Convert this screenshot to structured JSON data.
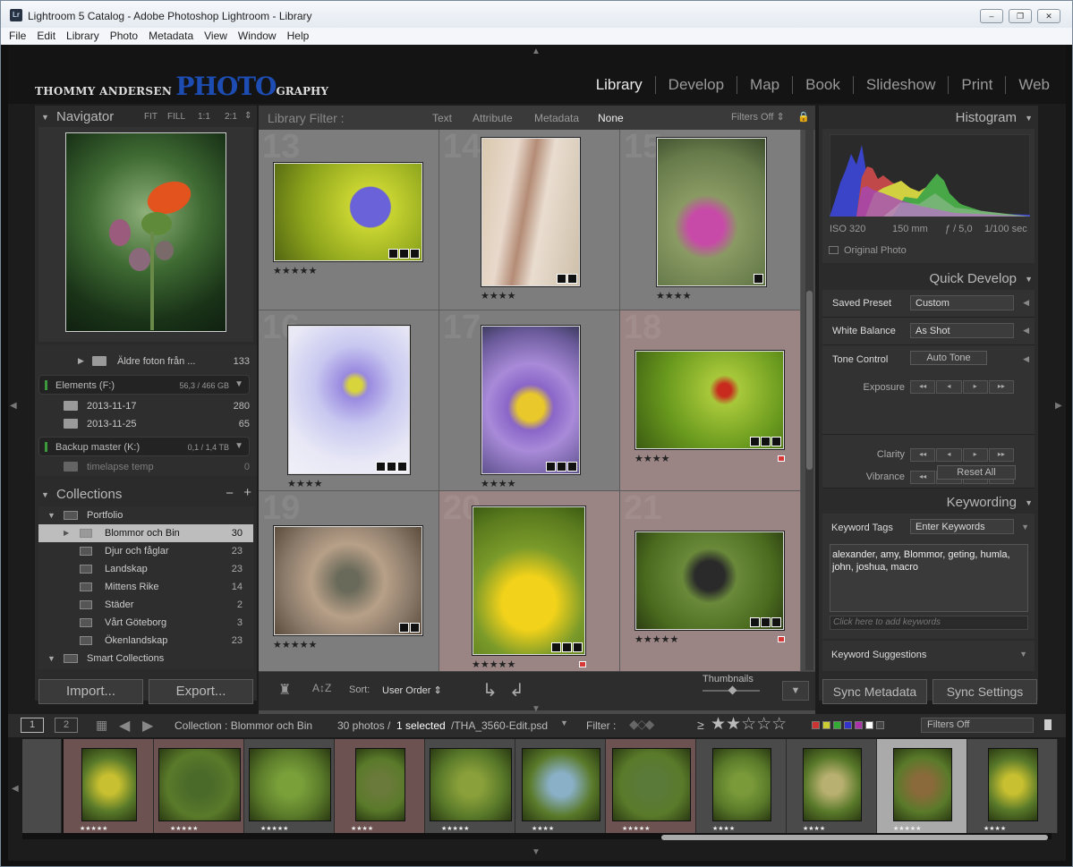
{
  "window": {
    "app_icon": "Lr",
    "title": "Lightroom 5 Catalog - Adobe Photoshop Lightroom - Library",
    "min": "–",
    "max": "❐",
    "close": "✕"
  },
  "menu": [
    "File",
    "Edit",
    "Library",
    "Photo",
    "Metadata",
    "View",
    "Window",
    "Help"
  ],
  "identity": {
    "part1": "THOMMY ANDERSEN",
    "part2": "PHOTO",
    "part3": "GRAPHY"
  },
  "modules": [
    "Library",
    "Develop",
    "Map",
    "Book",
    "Slideshow",
    "Print",
    "Web"
  ],
  "navigator": {
    "title": "Navigator",
    "zoom": [
      "FIT",
      "FILL",
      "1:1",
      "2:1"
    ],
    "zoom_arrow": "⇕"
  },
  "folders": {
    "older": {
      "name": "Äldre foton från ...",
      "count": "133"
    },
    "volume1": {
      "name": "Elements (F:)",
      "size": "56,3 / 466 GB"
    },
    "f1": {
      "name": "2013-11-17",
      "count": "280"
    },
    "f2": {
      "name": "2013-11-25",
      "count": "65"
    },
    "volume2": {
      "name": "Backup master (K:)",
      "size": "0,1 / 1,4 TB"
    },
    "f3": {
      "name": "timelapse temp",
      "count": "0"
    }
  },
  "collections": {
    "title": "Collections",
    "minus": "−",
    "plus": "+",
    "portfolio": "Portfolio",
    "items": [
      {
        "name": "Blommor och Bin",
        "count": "30"
      },
      {
        "name": "Djur och fåglar",
        "count": "23"
      },
      {
        "name": "Landskap",
        "count": "23"
      },
      {
        "name": "Mittens Rike",
        "count": "14"
      },
      {
        "name": "Städer",
        "count": "2"
      },
      {
        "name": "Vårt Göteborg",
        "count": "3"
      },
      {
        "name": "Ökenlandskap",
        "count": "23"
      }
    ],
    "smart": "Smart Collections"
  },
  "import_label": "Import...",
  "export_label": "Export...",
  "filterbar": {
    "label": "Library Filter :",
    "tabs": [
      "Text",
      "Attribute",
      "Metadata",
      "None"
    ],
    "filters": "Filters Off ⇕"
  },
  "grid": {
    "cells": [
      {
        "num": "13",
        "stars": "★★★★★"
      },
      {
        "num": "14",
        "stars": "★★★★"
      },
      {
        "num": "15",
        "stars": "★★★★"
      },
      {
        "num": "16",
        "stars": "★★★★"
      },
      {
        "num": "17",
        "stars": "★★★★"
      },
      {
        "num": "18",
        "stars": "★★★★"
      },
      {
        "num": "19",
        "stars": "★★★★★"
      },
      {
        "num": "20",
        "stars": "★★★★★"
      },
      {
        "num": "21",
        "stars": "★★★★★"
      }
    ]
  },
  "toolbar": {
    "sort_label": "Sort:",
    "sort_value": "User Order ⇕",
    "thumbnails": "Thumbnails",
    "az": "A↕Z"
  },
  "histogram": {
    "title": "Histogram",
    "iso": "ISO 320",
    "focal": "150 mm",
    "aperture": "ƒ / 5,0",
    "shutter": "1/100 sec",
    "original": "Original Photo"
  },
  "quick_develop": {
    "title": "Quick Develop",
    "saved_preset_label": "Saved Preset",
    "saved_preset": "Custom",
    "wb_label": "White Balance",
    "wb": "As Shot",
    "tone_label": "Tone Control",
    "auto_tone": "Auto Tone",
    "exposure": "Exposure",
    "clarity": "Clarity",
    "vibrance": "Vibrance",
    "reset": "Reset All",
    "step": [
      "◂◂",
      "◂",
      "▸",
      "▸▸"
    ]
  },
  "keywording": {
    "title": "Keywording",
    "tags_label": "Keyword Tags",
    "tags_select": "Enter Keywords",
    "keywords": "alexander, amy, Blommor, geting, humla, john, joshua, macro",
    "add_placeholder": "Click here to add keywords",
    "suggestions": "Keyword Suggestions"
  },
  "sync_metadata": "Sync Metadata",
  "sync_settings": "Sync Settings",
  "filmbar": {
    "b1": "1",
    "b2": "2",
    "source": "Collection : Blommor och Bin",
    "count": "30 photos /",
    "selected": "1 selected",
    "file": "/THA_3560-Edit.psd",
    "filter_label": "Filter :",
    "rating_ge": "≥",
    "rating_stars": "★★☆☆☆",
    "filters_off": "Filters Off"
  },
  "film": {
    "stars": [
      "★★★★★",
      "★★★★★",
      "★★★★★",
      "★★★★",
      "★★★★★",
      "★★★★",
      "★★★★★",
      "★★★★",
      "★★★★",
      "★★★★★",
      "★★★★"
    ]
  }
}
